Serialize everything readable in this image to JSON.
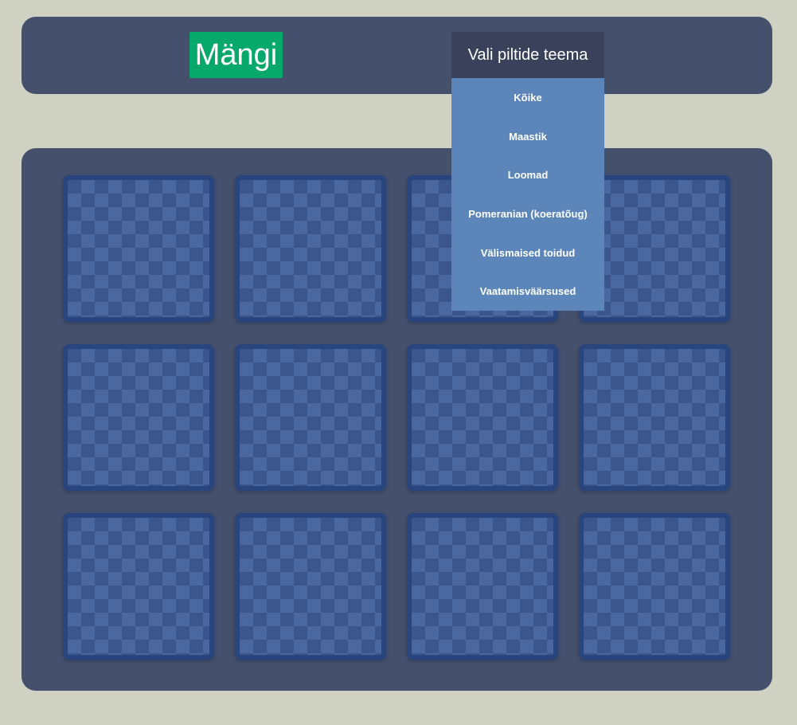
{
  "header": {
    "play_label": "Mängi"
  },
  "theme_select": {
    "label": "Vali piltide teema",
    "options": [
      "Kõike",
      "Maastik",
      "Loomad",
      "Pomeranian (koeratõug)",
      "Välismaised toidud",
      "Vaatamisväärsused"
    ]
  },
  "board": {
    "rows": 3,
    "columns": 4,
    "card_state": "face-down"
  },
  "colors": {
    "page_background": "#cfd2c2",
    "panel": "#44506c",
    "play_button": "#07a86b",
    "dropdown_header": "#39425a",
    "dropdown_menu": "#5c86b9",
    "card_border": "#29457e",
    "card_face": "#3a568d",
    "card_pattern": "#4a67a0"
  }
}
